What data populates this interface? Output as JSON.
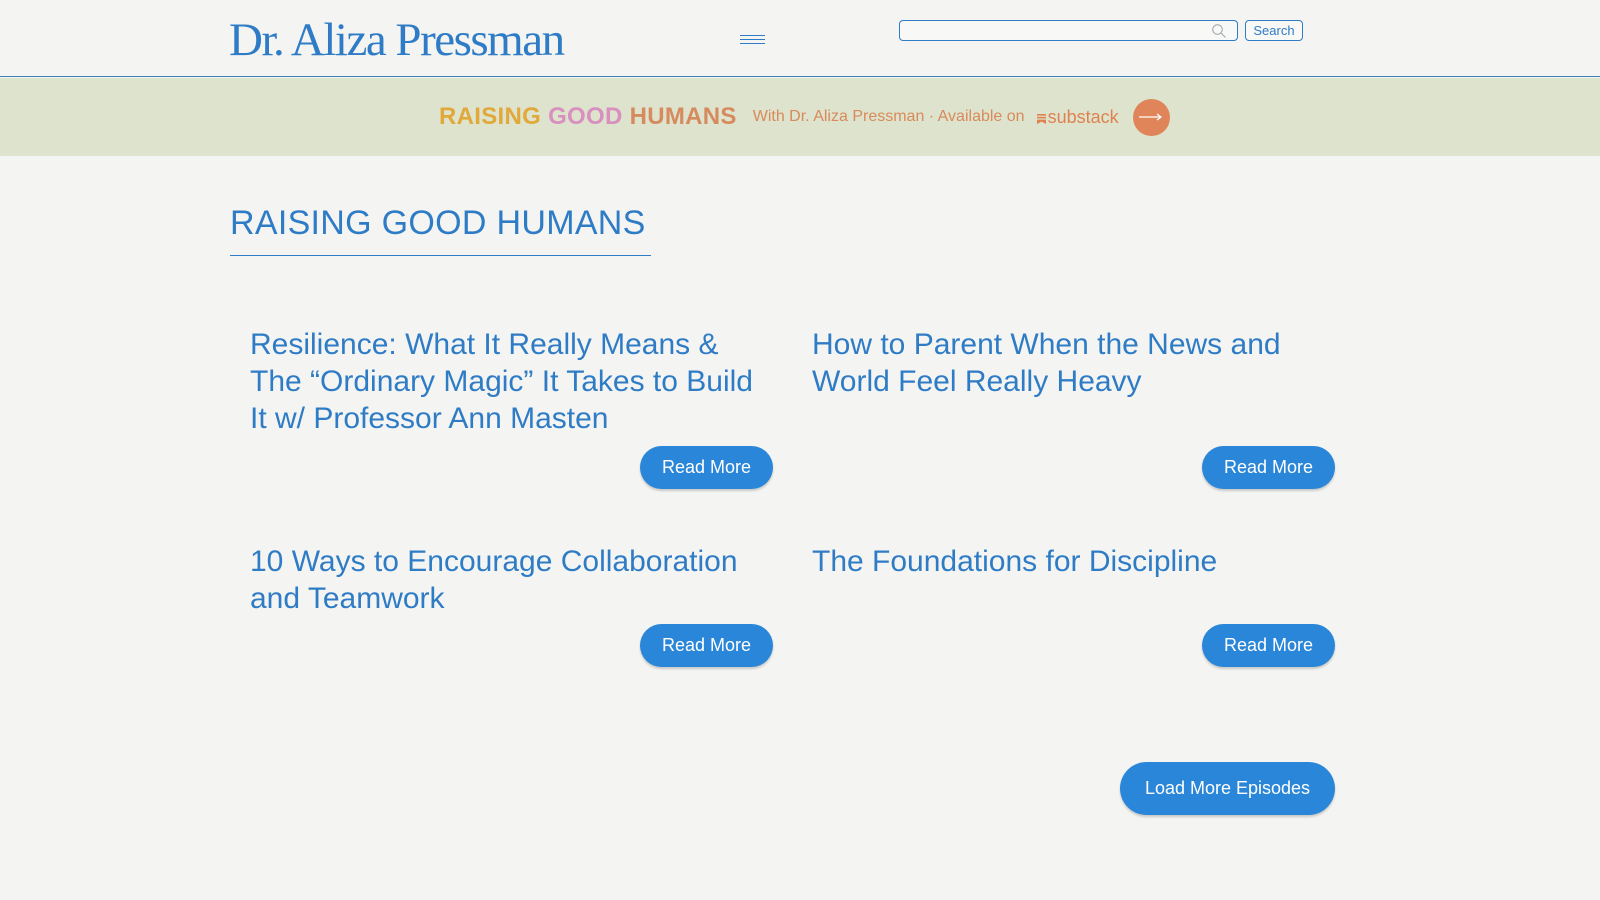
{
  "header": {
    "logo_text": "Dr. Aliza Pressman",
    "search": {
      "value": "",
      "placeholder": "",
      "button_label": "Search",
      "icon": "search-icon"
    },
    "menu_icon": "hamburger-menu-icon"
  },
  "banner": {
    "brand_words": [
      "RAISING",
      "GOOD",
      "HUMANS"
    ],
    "subtitle": "With Dr. Aliza Pressman · Available on",
    "platform": "substack",
    "arrow_icon": "arrow-right-icon",
    "colors": {
      "background": "#dde3cd",
      "word1": "#e0a93a",
      "word2": "#d98fbf",
      "word3": "#d68a5e",
      "accent": "#e0855a"
    }
  },
  "main": {
    "page_title": "RAISING GOOD HUMANS",
    "episodes": [
      {
        "title": "Resilience: What It Really Means & The “Ordinary Magic” It Takes to Build It w/ Professor Ann Masten",
        "button_label": "Read More"
      },
      {
        "title": "How to Parent When the News and World Feel Really Heavy",
        "button_label": "Read More"
      },
      {
        "title": "10 Ways to Encourage Collaboration and Teamwork",
        "button_label": "Read More"
      },
      {
        "title": "The Foundations for Discipline",
        "button_label": "Read More"
      }
    ],
    "load_more_label": "Load More Episodes"
  },
  "theme": {
    "brand_blue": "#2f7cc6",
    "button_blue": "#2a86d8",
    "page_background": "#f4f4f2"
  }
}
